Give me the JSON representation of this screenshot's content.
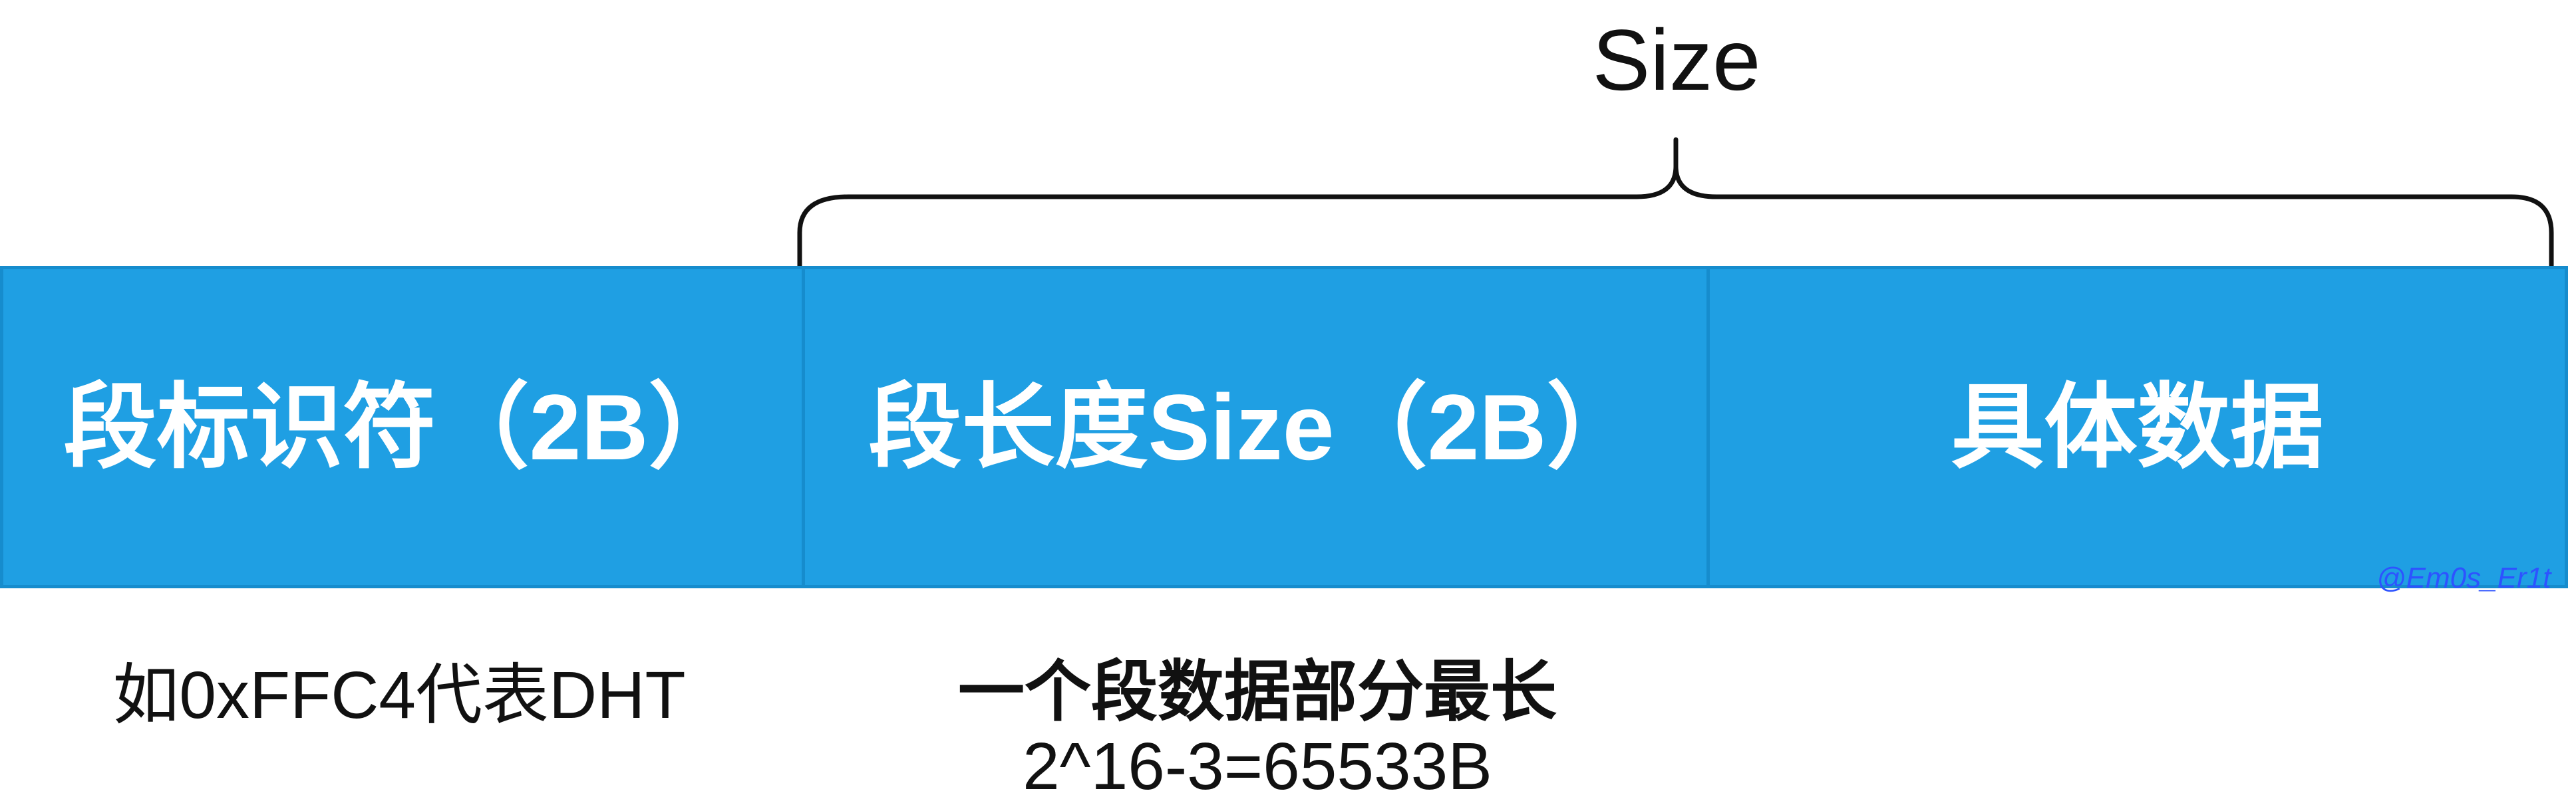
{
  "top_label": "Size",
  "segments": [
    {
      "label": "段标识符（2B）"
    },
    {
      "label": "段长度Size（2B）"
    },
    {
      "label": "具体数据"
    }
  ],
  "notes": {
    "segment_id": "如0xFFC4代表DHT",
    "segment_length_line1": "一个段数据部分最长",
    "segment_length_line2": "2^16-3=65533B"
  },
  "watermark": "@Em0s_Er1t",
  "colors": {
    "segment_fill": "#1f9fe3",
    "segment_border": "#168ccd",
    "segment_text": "#ffffff",
    "watermark": "#2d53ff"
  }
}
